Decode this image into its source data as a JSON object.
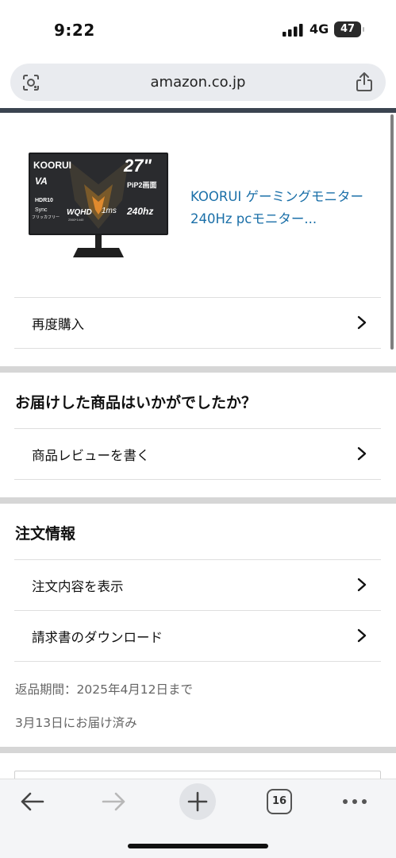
{
  "status_bar": {
    "time": "9:22",
    "network": "4G",
    "battery": "47"
  },
  "browser": {
    "url": "amazon.co.jp",
    "tab_count": "16"
  },
  "product": {
    "title": "KOORUI ゲーミングモニター 240Hz pcモニター...",
    "image_texts": {
      "brand": "KOORUI",
      "size": "27\"",
      "panel": "VA",
      "pip": "PiP2画面",
      "hdr": "HDR10",
      "sync": "Sync",
      "flicker": "フリッカフリー",
      "res": "WQHD",
      "res_detail": "2560*1440",
      "response": "1ms",
      "refresh": "240hz"
    }
  },
  "rows": {
    "buy_again": "再度購入",
    "write_review": "商品レビューを書く",
    "view_order": "注文内容を表示",
    "download_invoice": "請求書のダウンロード"
  },
  "sections": {
    "feedback_heading": "お届けした商品はいかがでしたか？",
    "order_info_heading": "注文情報"
  },
  "order_info": {
    "return_period": "返品期間：2025年4月12日まで",
    "delivered": "3月13日にお届け済み"
  },
  "colors": {
    "link": "#1a6fa8",
    "separator": "#d6d6d6",
    "header_line": "#3b4450"
  }
}
